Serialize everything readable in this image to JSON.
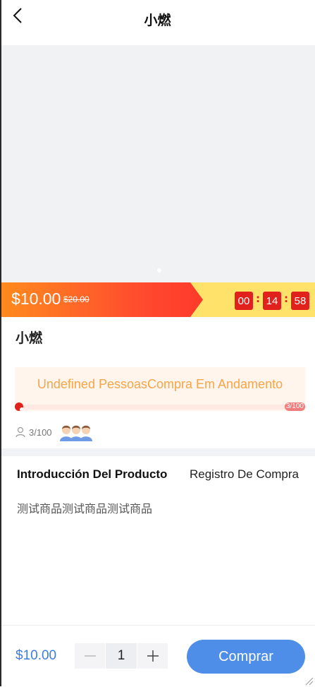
{
  "header": {
    "title": "小燃"
  },
  "price": {
    "current": "$10.00",
    "original": "$20.00"
  },
  "countdown": {
    "hours": "00",
    "minutes": "14",
    "seconds": "58",
    "separator": ":"
  },
  "product": {
    "name": "小燃",
    "description": "测试商品测试商品测试商品"
  },
  "group_buy": {
    "status_text": "Undefined PessoasCompra Em Andamento",
    "progress_label": "3/100",
    "progress_fraction": 0.03
  },
  "participants": {
    "count_label": "3/100"
  },
  "tabs": [
    {
      "label": "Introducción Del Producto",
      "active": true
    },
    {
      "label": "Registro De Compra",
      "active": false
    }
  ],
  "bottom_bar": {
    "price": "$10.00",
    "quantity": "1",
    "buy_label": "Comprar"
  },
  "icons": [
    "back-icon",
    "user-icon",
    "avatar-icon",
    "minus-icon",
    "plus-icon"
  ],
  "colors": {
    "accent": "#4f8ee8",
    "price_red": "#ff4a2e",
    "timer_red": "#e0211c",
    "promo_yellow": "#ffe26a",
    "status_orange": "#f5a54a"
  }
}
